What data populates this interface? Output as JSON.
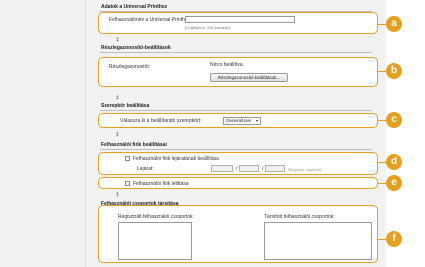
{
  "sections": {
    "univ_printing": {
      "title": "Adatok a Universal Printhez",
      "field_label": "Felhasználónév a Universal Printhez:",
      "field_value": "",
      "hint": "(Legfeljebb: 256 karakter)"
    },
    "auth": {
      "title": "Részlegazonosító-beállítások",
      "label": "Részlegazonosító:",
      "status": "Nincs beállítva.",
      "button": "Részlegazonosító-beállítások..."
    },
    "role": {
      "title": "Szerepkör beállítása",
      "label": "Válassza ki a beállítandó szerepkört:",
      "selected": "GeneralUser"
    },
    "account": {
      "title": "Felhasználói fiók beállításai",
      "expiry_label": "Felhasználói fiók lejáratának beállítása",
      "expiry_date_label": "Lejárat:",
      "date_sep1": "/",
      "date_sep2": "/",
      "date_hint": "Megadás naptárral",
      "disable_label": "Felhasználói fiók letiltása"
    },
    "groups": {
      "title": "Felhasználói csoportok társítása",
      "registered_label": "Regisztrált felhasználói csoportok:",
      "associated_label": "Társított felhasználói csoportok:"
    }
  },
  "callouts": [
    "a",
    "b",
    "c",
    "d",
    "e",
    "f"
  ],
  "collapse_glyph": "‡",
  "dropdown_arrow": "▾",
  "colors": {
    "accent": "#e6a01e",
    "panel": "#f2f2f2"
  }
}
